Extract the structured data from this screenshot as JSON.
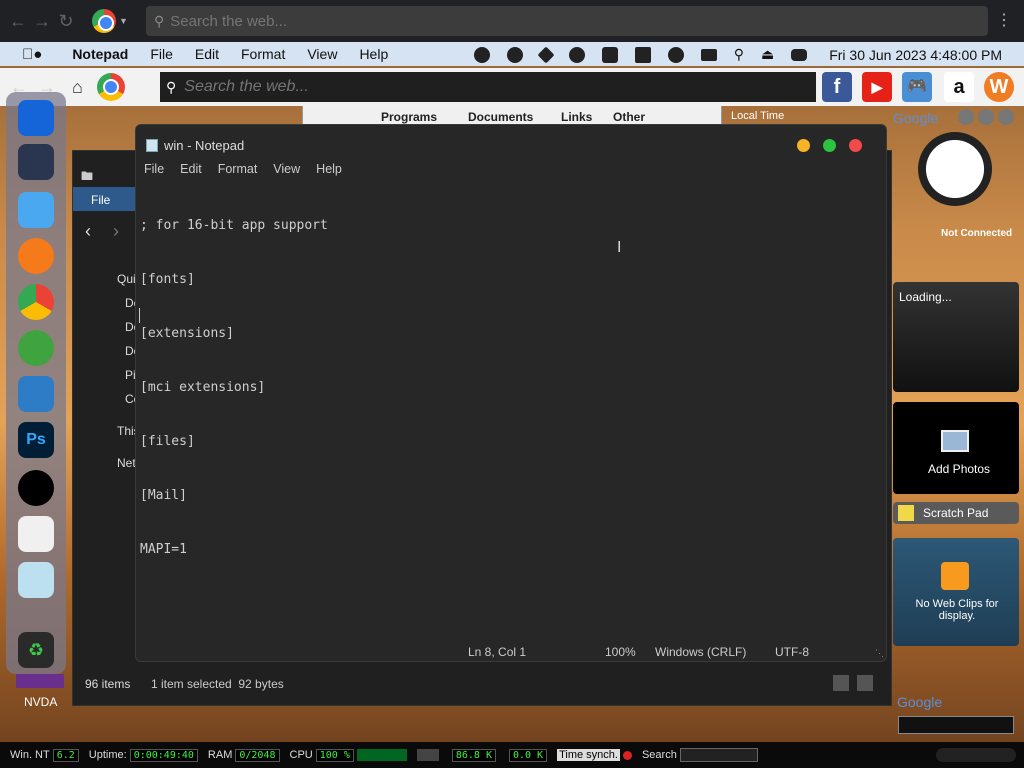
{
  "browser_top": {
    "search_placeholder": "Search the web..."
  },
  "menubar": {
    "app_name": "Notepad",
    "items": [
      "File",
      "Edit",
      "Format",
      "View",
      "Help"
    ],
    "clock": "Fri 30 Jun 2023 4:48:00 PM"
  },
  "browser_second": {
    "search_placeholder": "Search the web...",
    "shortcuts": [
      {
        "name": "facebook",
        "label": "f",
        "color": "#3b5998"
      },
      {
        "name": "youtube",
        "label": "▶",
        "color": "#e62117"
      },
      {
        "name": "games",
        "label": "🎮",
        "color": "#4a8fd4"
      },
      {
        "name": "amazon",
        "label": "a",
        "color": "#ffffff"
      },
      {
        "name": "w-app",
        "label": "W",
        "color": "#f07c24"
      }
    ]
  },
  "programs_bar": {
    "items": [
      "Programs",
      "Documents",
      "Links",
      "Other"
    ],
    "local_time": "Local Time"
  },
  "explorer": {
    "ribbon_tab": "File",
    "nav_items": [
      "Qui",
      "De",
      "Do",
      "Do",
      "Pi",
      "Co",
      "This",
      "Net"
    ],
    "status_count": "96 items",
    "status_selected": "1 item selected  92 bytes"
  },
  "notepad": {
    "title": "win - Notepad",
    "menu": [
      "File",
      "Edit",
      "Format",
      "View",
      "Help"
    ],
    "lines": [
      "; for 16-bit app support",
      "[fonts]",
      "[extensions]",
      "[mci extensions]",
      "[files]",
      "[Mail]",
      "MAPI=1",
      ""
    ],
    "status": {
      "position": "Ln 8, Col 1",
      "zoom": "100%",
      "line_ending": "Windows (CRLF)",
      "encoding": "UTF-8"
    }
  },
  "gadgets": {
    "google_header": "Google",
    "not_connected": "Not Connected",
    "loading": "Loading...",
    "add_photos": "Add Photos",
    "scratch_pad": "Scratch Pad",
    "web_clips": "No Web Clips for display.",
    "google_bottom": "Google"
  },
  "desktop": {
    "nvda_label": "NVDA"
  },
  "taskbar": {
    "os_label": "Win. NT",
    "os_version": "6.2",
    "uptime_label": "Uptime:",
    "uptime_value": "0:00:49:40",
    "ram_label": "RAM",
    "ram_value": "0/2048",
    "cpu_label": "CPU",
    "cpu_value": "100 %",
    "net_down": "86.8 K",
    "net_up": "0.0 K",
    "time_sync": "Time synch.",
    "search_label": "Search"
  },
  "colors": {
    "traffic_yellow": "#f5b428",
    "traffic_green": "#2bc340",
    "traffic_red": "#f04a4a"
  }
}
